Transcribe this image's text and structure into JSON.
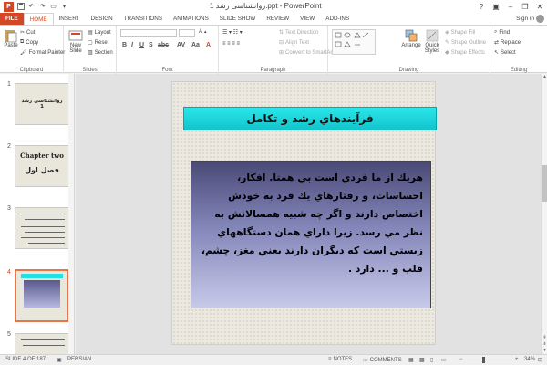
{
  "titlebar": {
    "title": "روانشناسی رشد 1.ppt - PowerPoint",
    "help": "?"
  },
  "tabs": [
    {
      "label": "FILE"
    },
    {
      "label": "HOME"
    },
    {
      "label": "INSERT"
    },
    {
      "label": "DESIGN"
    },
    {
      "label": "TRANSITIONS"
    },
    {
      "label": "ANIMATIONS"
    },
    {
      "label": "SLIDE SHOW"
    },
    {
      "label": "REVIEW"
    },
    {
      "label": "VIEW"
    },
    {
      "label": "ADD-INS"
    }
  ],
  "signin": "Sign in",
  "ribbon": {
    "clipboard": {
      "name": "Clipboard",
      "paste": "Paste",
      "cut": "Cut",
      "copy": "Copy",
      "format_painter": "Format Painter"
    },
    "slides": {
      "name": "Slides",
      "new_slide": "New Slide",
      "layout": "Layout",
      "reset": "Reset",
      "section": "Section"
    },
    "font": {
      "name": "Font"
    },
    "paragraph": {
      "name": "Paragraph",
      "text_direction": "Text Direction",
      "align_text": "Align Text",
      "convert": "Convert to SmartArt"
    },
    "drawing": {
      "name": "Drawing",
      "arrange": "Arrange",
      "quick_styles": "Quick Styles",
      "shape_fill": "Shape Fill",
      "shape_outline": "Shape Outline",
      "shape_effects": "Shape Effects"
    },
    "editing": {
      "name": "Editing",
      "find": "Find",
      "replace": "Replace",
      "select": "Select"
    }
  },
  "thumbnails": [
    {
      "num": "1",
      "text": "روانشناسی رشد 1"
    },
    {
      "num": "2",
      "text_a": "Chapter two",
      "text_b": "فصل اول"
    },
    {
      "num": "3"
    },
    {
      "num": "4"
    },
    {
      "num": "5"
    }
  ],
  "slide": {
    "title": "فرآيندهاي رشد و تكامل",
    "body": "هريك از ما فردي است بي همتا. افكار، احساسات، و رفتارهاي يك فرد به خودش اختصاص دارند و اگر چه شبيه همسالانش به نظر مي رسد. زيرا داراي همان دستگاههاي زيستي است كه ديگران دارند يعني مغز، چشم، قلب و ... دارد ."
  },
  "status": {
    "slide_of": "SLIDE 4 OF 187",
    "language": "PERSIAN",
    "notes": "NOTES",
    "comments": "COMMENTS",
    "zoom": "34%"
  }
}
